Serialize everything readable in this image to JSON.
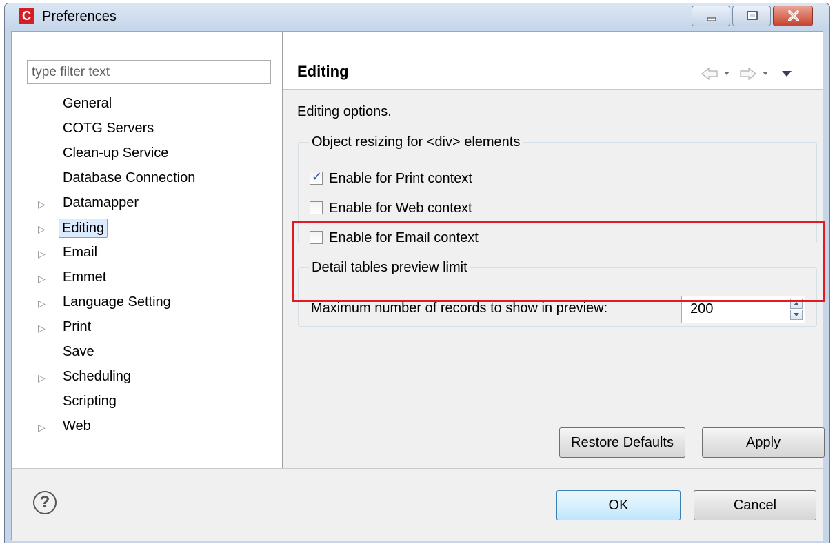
{
  "window": {
    "title": "Preferences",
    "app_icon_letter": "C",
    "accent_color": "#d31e25",
    "controls": [
      "minimize",
      "maximize",
      "close"
    ]
  },
  "filter": {
    "placeholder": "type filter text",
    "value": ""
  },
  "tree": {
    "items": [
      {
        "label": "General",
        "expandable": false,
        "selected": false
      },
      {
        "label": "COTG Servers",
        "expandable": false,
        "selected": false
      },
      {
        "label": "Clean-up Service",
        "expandable": false,
        "selected": false
      },
      {
        "label": "Database Connection",
        "expandable": false,
        "selected": false
      },
      {
        "label": "Datamapper",
        "expandable": true,
        "selected": false
      },
      {
        "label": "Editing",
        "expandable": true,
        "selected": true
      },
      {
        "label": "Email",
        "expandable": true,
        "selected": false
      },
      {
        "label": "Emmet",
        "expandable": true,
        "selected": false
      },
      {
        "label": "Language Setting",
        "expandable": true,
        "selected": false
      },
      {
        "label": "Print",
        "expandable": true,
        "selected": false
      },
      {
        "label": "Save",
        "expandable": false,
        "selected": false
      },
      {
        "label": "Scheduling",
        "expandable": true,
        "selected": false
      },
      {
        "label": "Scripting",
        "expandable": false,
        "selected": false
      },
      {
        "label": "Web",
        "expandable": true,
        "selected": false
      }
    ]
  },
  "page": {
    "title": "Editing",
    "description": "Editing options.",
    "nav_icons": [
      "back-arrow-icon",
      "dropdown-icon",
      "forward-arrow-icon",
      "dropdown-icon",
      "view-menu-icon"
    ]
  },
  "object_resizing": {
    "legend": "Object resizing for <div> elements",
    "options": [
      {
        "label": "Enable for Print context",
        "checked": true
      },
      {
        "label": "Enable for Web context",
        "checked": false
      },
      {
        "label": "Enable for Email context",
        "checked": false
      }
    ]
  },
  "detail_tables": {
    "legend": "Detail tables preview limit",
    "label": "Maximum number of records to show in preview:",
    "value": "200",
    "highlight_color": "#e01b24"
  },
  "buttons": {
    "restore_defaults": "Restore Defaults",
    "apply": "Apply",
    "ok": "OK",
    "cancel": "Cancel",
    "help_icon": "?"
  }
}
